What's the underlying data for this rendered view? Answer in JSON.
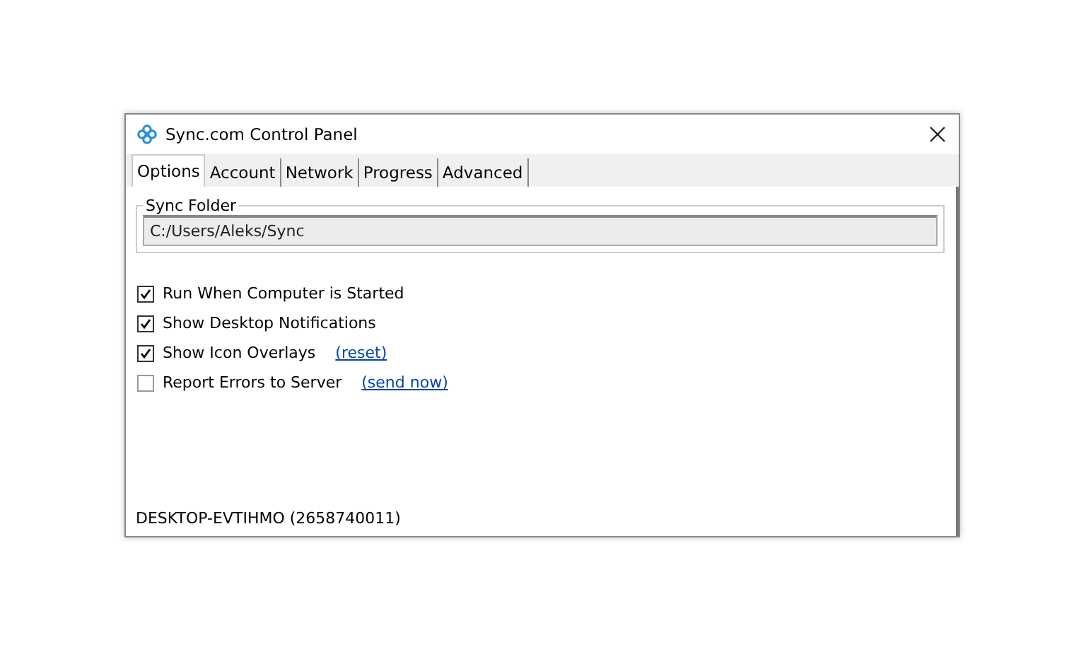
{
  "window": {
    "title": "Sync.com Control Panel"
  },
  "tabs": [
    {
      "label": "Options",
      "selected": true
    },
    {
      "label": "Account",
      "selected": false
    },
    {
      "label": "Network",
      "selected": false
    },
    {
      "label": "Progress",
      "selected": false
    },
    {
      "label": "Advanced",
      "selected": false
    }
  ],
  "sync_folder": {
    "label": "Sync Folder",
    "value": "C:/Users/Aleks/Sync"
  },
  "options": [
    {
      "label": "Run When Computer is Started",
      "checked": true
    },
    {
      "label": "Show Desktop Notifications",
      "checked": true
    },
    {
      "label": "Show Icon Overlays",
      "checked": true,
      "link": "(reset)"
    },
    {
      "label": "Report Errors to Server",
      "checked": false,
      "link": "(send now)"
    }
  ],
  "status_bar": "DESKTOP-EVTIHMO (2658740011)"
}
